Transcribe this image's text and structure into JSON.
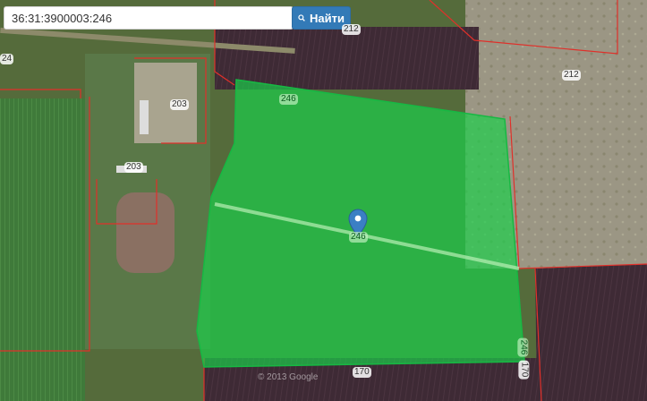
{
  "search": {
    "value": "36:31:3900003:246"
  },
  "find_button": {
    "label": "Найти",
    "icon": "search-icon"
  },
  "parcel_labels": {
    "p212_top": "212",
    "p212_right": "212",
    "p203_a": "203",
    "p203_b": "203",
    "p246_top": "246",
    "p246_center": "246",
    "p246_right": "246",
    "p170_bottom": "170",
    "p170_right": "170",
    "p24": "24"
  },
  "watermark": "© 2013 Google",
  "colors": {
    "selected_parcel": "#19d24a",
    "parcel_border": "#e0302a",
    "marker": "#3b7fc4"
  }
}
